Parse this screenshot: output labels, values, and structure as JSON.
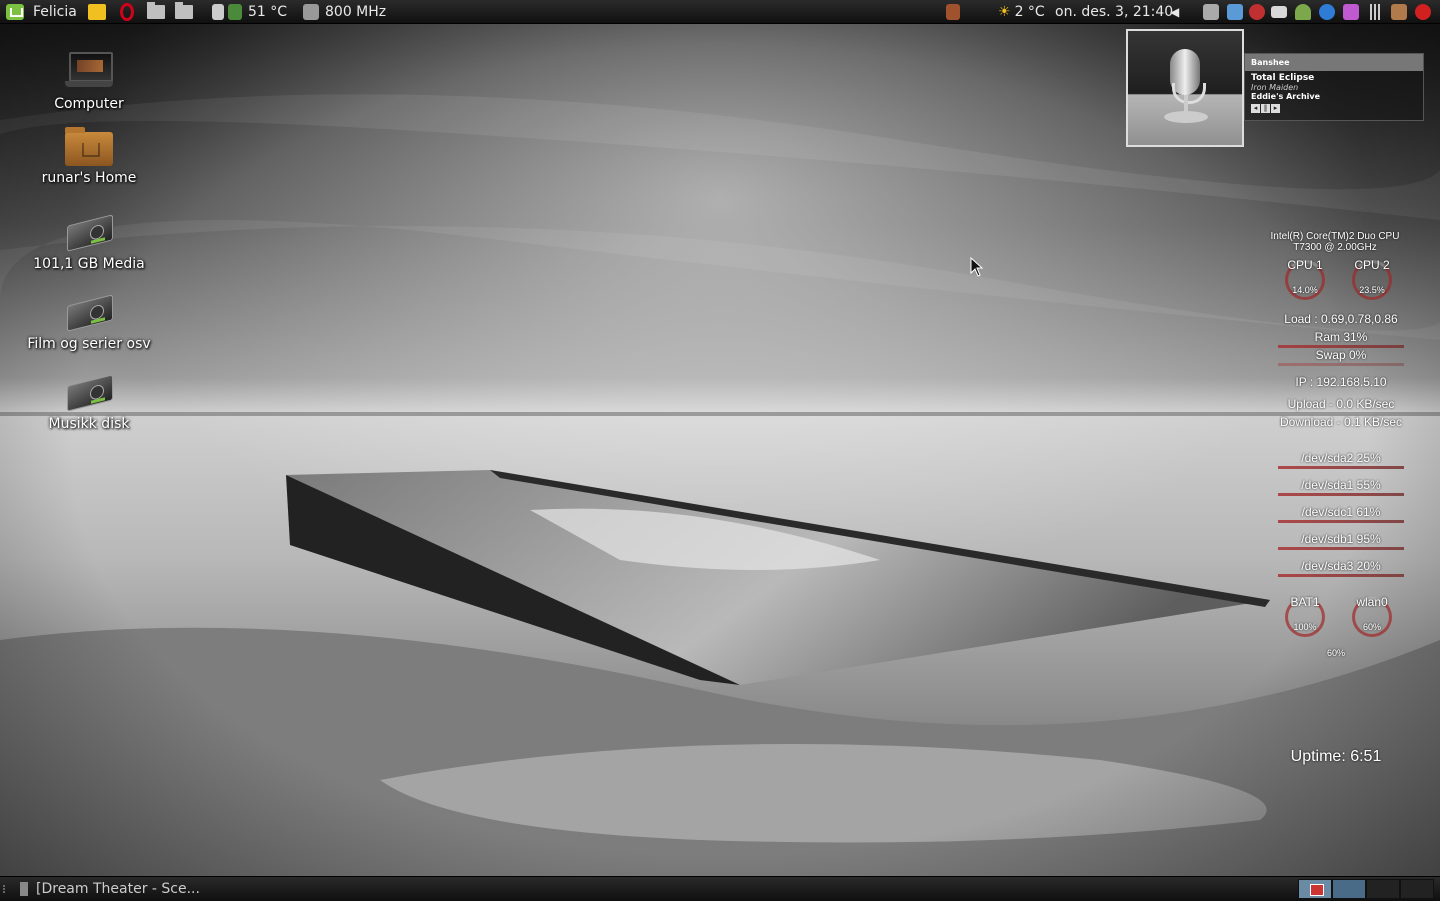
{
  "top_panel": {
    "menu_label": "Felicia",
    "cpu_temp": "51 °C",
    "cpu_freq": "800 MHz",
    "weather": "2 °C",
    "clock": "on. des.  3, 21:40"
  },
  "desktop_icons": [
    {
      "label": "Computer",
      "icon": "computer-icon"
    },
    {
      "label": "runar's Home",
      "icon": "home-folder-icon"
    },
    {
      "label": "101,1 GB Media",
      "icon": "drive-icon"
    },
    {
      "label": "Film og serier osv",
      "icon": "drive-icon"
    },
    {
      "label": "Musikk disk",
      "icon": "drive-icon"
    }
  ],
  "media_widget": {
    "app": "Banshee",
    "title": "Total Eclipse",
    "artist": "Iron Maiden",
    "album": "Eddie's Archive"
  },
  "conky": {
    "cpu_name_1": "Intel(R) Core(TM)2 Duo CPU",
    "cpu_name_2": "T7300  @ 2.00GHz",
    "cpu1_label": "CPU 1",
    "cpu1_value": "14.0%",
    "cpu2_label": "CPU 2",
    "cpu2_value": "23.5%",
    "load": "Load : 0.69,0.78,0.86",
    "ram": "Ram 31%",
    "swap": "Swap 0%",
    "ip": "IP : 192.168.5.10",
    "upload": "Upload - 0.0 KB/sec",
    "download": "Download - 0.1 KB/sec",
    "disks": [
      {
        "label": "/dev/sda2 25%"
      },
      {
        "label": "/dev/sda1 55%"
      },
      {
        "label": "/dev/sdc1 61%"
      },
      {
        "label": "/dev/sdb1 95%"
      },
      {
        "label": "/dev/sda3 20%"
      }
    ],
    "bat_label": "BAT1",
    "bat_value": "100%",
    "wlan_label": "wlan0",
    "wlan_value": "60%",
    "wlan_extra": "60%",
    "uptime": "Uptime: 6:51"
  },
  "bottom_panel": {
    "task_label": "[Dream Theater - Sce..."
  },
  "colors": {
    "mint_green": "#7cc242",
    "conky_bar": "#a33333"
  }
}
